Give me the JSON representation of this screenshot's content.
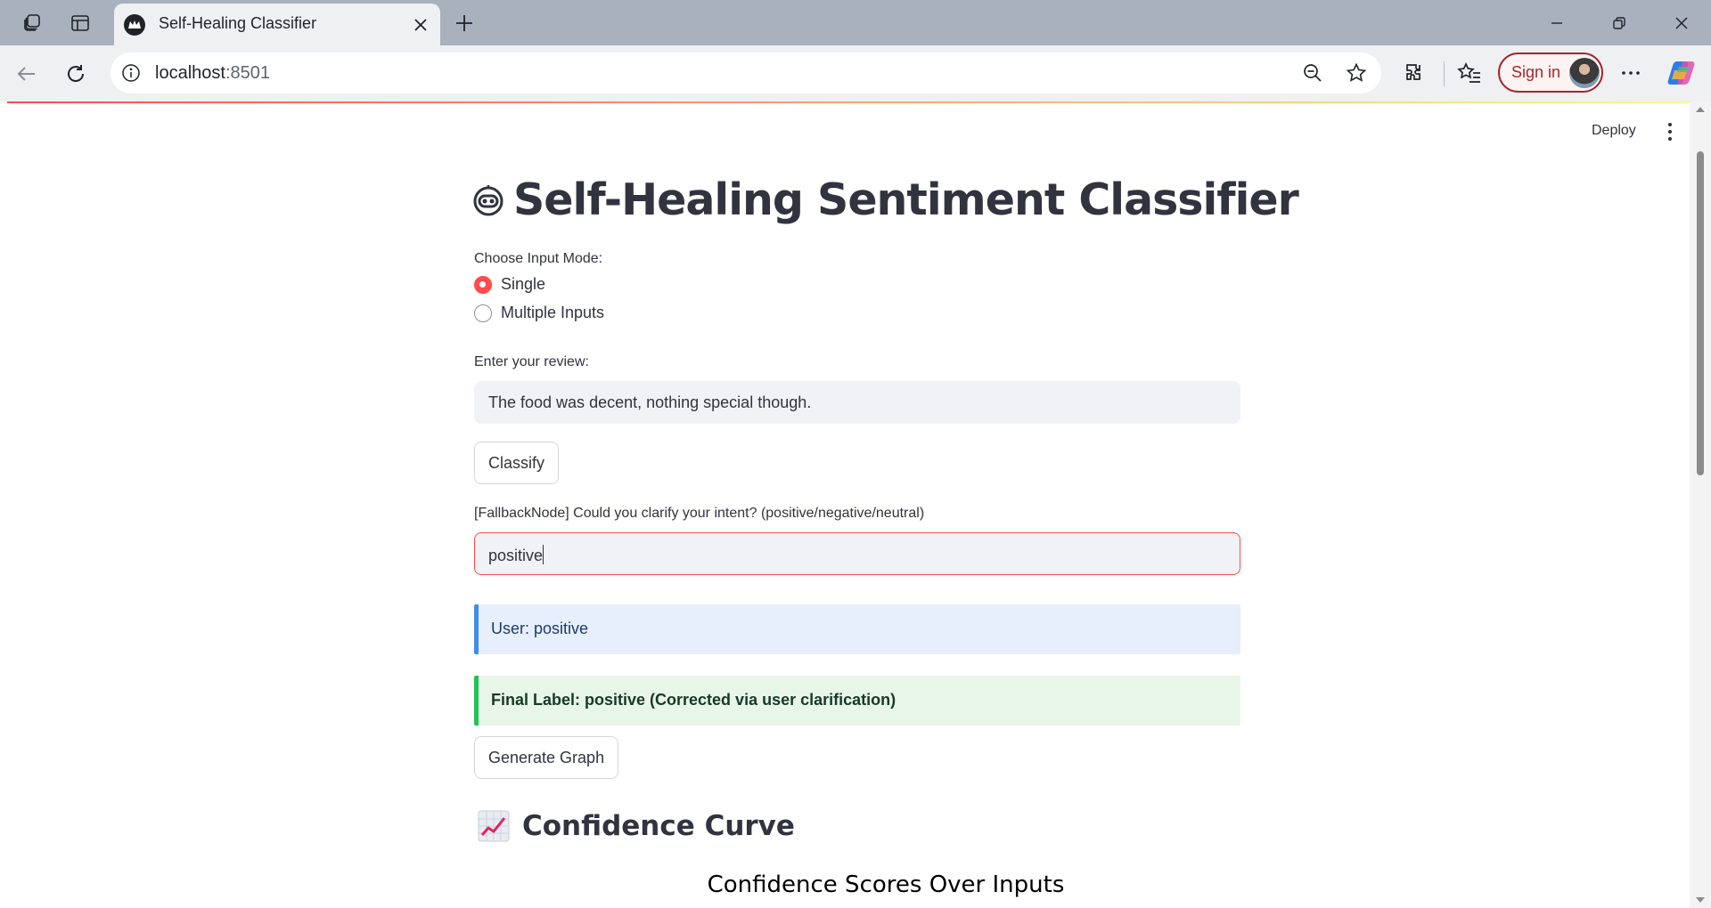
{
  "browser": {
    "tab_title": "Self-Healing Classifier",
    "url_host": "localhost",
    "url_port": ":8501",
    "sign_in_label": "Sign in"
  },
  "app": {
    "deploy_label": "Deploy",
    "title": "Self-Healing Sentiment Classifier",
    "input_mode": {
      "label": "Choose Input Mode:",
      "options": [
        "Single",
        "Multiple Inputs"
      ],
      "selected": "Single"
    },
    "review": {
      "label": "Enter your review:",
      "value": "The food was decent, nothing special though."
    },
    "classify_button": "Classify",
    "clarify": {
      "label": "[FallbackNode] Could you clarify your intent? (positive/negative/neutral)",
      "value": "positive"
    },
    "user_message": "User: positive",
    "final_label": "Final Label: positive (Corrected via user clarification)",
    "generate_graph_button": "Generate Graph",
    "section_title": "Confidence Curve",
    "chart_title": "Confidence Scores Over Inputs"
  },
  "colors": {
    "primary": "#ff4b4b",
    "info_bg": "#e6effb",
    "info_border": "#3c8eea",
    "success_bg": "#e8f6ea",
    "success_border": "#21c354",
    "signin": "#a4262c"
  }
}
